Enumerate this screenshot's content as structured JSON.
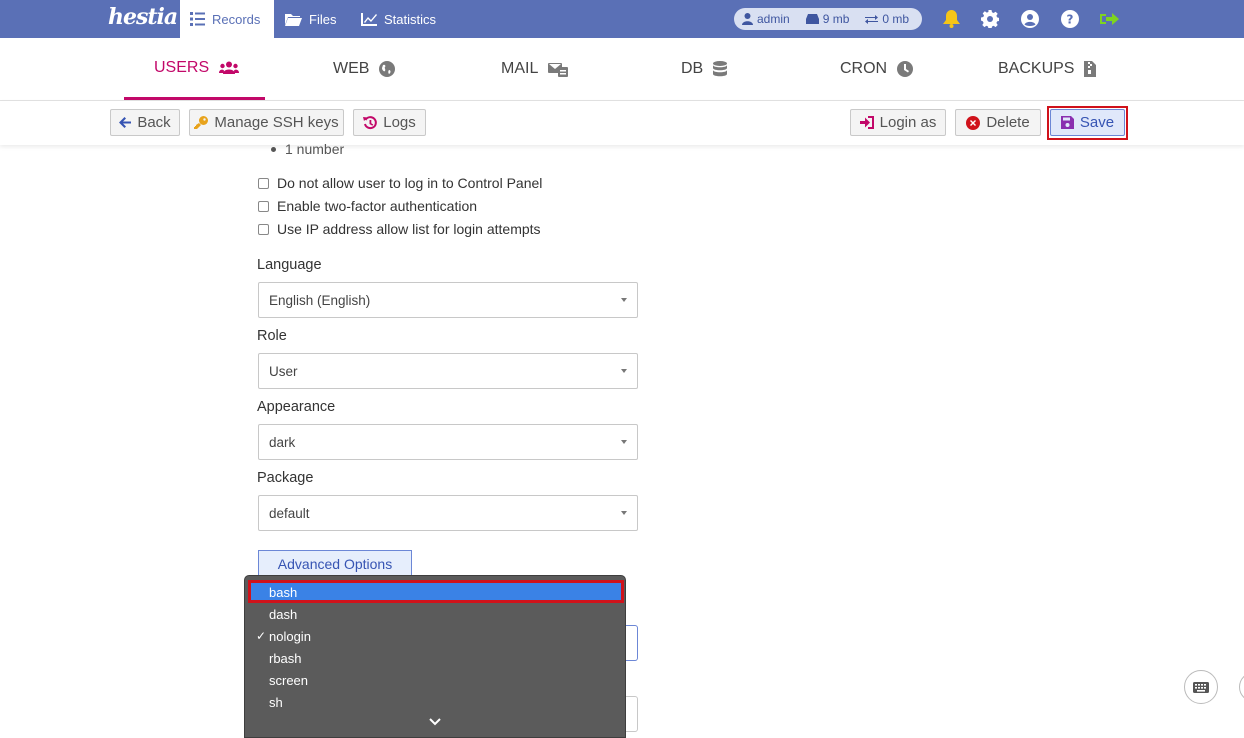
{
  "app": {
    "logo": "hestia"
  },
  "topnav": {
    "items": [
      {
        "label": "Records",
        "icon": "list-icon",
        "active": true
      },
      {
        "label": "Files",
        "icon": "folder-icon"
      },
      {
        "label": "Statistics",
        "icon": "chart-line-icon"
      }
    ]
  },
  "status": {
    "user": "admin",
    "disk": "9 mb",
    "bandwidth": "0 mb"
  },
  "tabs": [
    {
      "label": "USERS",
      "icon": "users-icon",
      "active": true
    },
    {
      "label": "WEB",
      "icon": "globe-icon"
    },
    {
      "label": "MAIL",
      "icon": "mail-icon"
    },
    {
      "label": "DB",
      "icon": "database-icon"
    },
    {
      "label": "CRON",
      "icon": "clock-icon"
    },
    {
      "label": "BACKUPS",
      "icon": "file-archive-icon"
    }
  ],
  "toolbar": {
    "back": "Back",
    "ssh_keys": "Manage SSH keys",
    "logs": "Logs",
    "login_as": "Login as",
    "delete": "Delete",
    "save": "Save"
  },
  "form": {
    "password_rule": "1 number",
    "checkboxes": [
      "Do not allow user to log in to Control Panel",
      "Enable two-factor authentication",
      "Use IP address allow list for login attempts"
    ],
    "language": {
      "label": "Language",
      "value": "English (English)"
    },
    "role": {
      "label": "Role",
      "value": "User"
    },
    "appearance": {
      "label": "Appearance",
      "value": "dark"
    },
    "package": {
      "label": "Package",
      "value": "default"
    },
    "advanced_options": "Advanced Options"
  },
  "shell_dropdown": {
    "options": [
      "bash",
      "dash",
      "nologin",
      "rbash",
      "screen",
      "sh"
    ],
    "highlighted": "bash",
    "checked": "nologin",
    "check_mark": "✓"
  },
  "colors": {
    "header": "#5a70b6",
    "accent": "#c20869",
    "highlight_red": "#d0121b",
    "option_selected": "#3a82e6"
  }
}
